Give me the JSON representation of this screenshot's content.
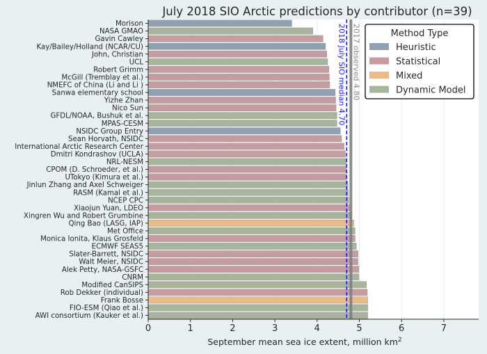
{
  "chart_data": {
    "type": "bar",
    "orientation": "horizontal",
    "title": "July 2018 SIO Arctic predictions by contributor (n=39)",
    "xlabel": "September mean sea ice extent, million km",
    "xlabel_superscript": "2",
    "ylabel": "",
    "xlim": [
      0,
      7.8
    ],
    "xticks": [
      0,
      1,
      2,
      3,
      4,
      5,
      6,
      7
    ],
    "grid": "vertical",
    "method_colors": {
      "Heuristic": "#8ea0b2",
      "Statistical": "#c59ca0",
      "Mixed": "#ebbb86",
      "Dynamic Model": "#a9b59b"
    },
    "legend": {
      "title": "Method Type",
      "placement": "top-right",
      "entries": [
        "Heuristic",
        "Statistical",
        "Mixed",
        "Dynamic Model"
      ]
    },
    "reference_lines": [
      {
        "name": "median",
        "value": 4.7,
        "label": "2018 July SIO median 4.70",
        "color": "#1a1aff",
        "style": "dashed"
      },
      {
        "name": "observed",
        "value": 4.8,
        "label": "2017 observed 4.80",
        "color": "#808080",
        "style": "solid"
      }
    ],
    "categories": [
      "Morison",
      "NASA GMAO",
      "Gavin Cawley",
      "Kay/Bailey/Holland (NCAR/CU)",
      "John, Christian",
      "UCL",
      "Robert Grimm",
      "McGill (Tremblay et al.)",
      "NMEFC of China (Li and Li )",
      "Sanwa elementary school",
      "Yizhe Zhan",
      "Nico Sun",
      "GFDL/NOAA, Bushuk et al.",
      "MPAS-CESM",
      "NSIDC Group Entry",
      "Sean Horvath, NSIDC",
      "International Arctic Research Center",
      "Dmitri Kondrashov (UCLA)",
      "NRL-NESM",
      "CPOM (D. Schroeder, et al.)",
      "UTokyo (Kimura et al.)",
      "Jinlun Zhang and Axel Schweiger",
      "RASM (Kamal et al.)",
      "NCEP CPC",
      "Xiaojun Yuan, LDEO",
      "Xingren Wu and Robert Grumbine",
      "Qing Bao (LASG, IAP)",
      "Met Office",
      "Monica Ionita, Klaus Grosfeld",
      "ECMWF SEAS5",
      "Slater-Barrett, NSIDC",
      "Walt Meier, NSIDC",
      "Alek Petty, NASA-GSFC",
      "CNRM",
      "Modified CanSIPS",
      "Rob Dekker (individual)",
      "Frank Bosse",
      "FIO-ESM (Qiao et al.)",
      "AWI consortium (Kauker et al.)"
    ],
    "values": [
      3.4,
      3.9,
      4.14,
      4.2,
      4.23,
      4.25,
      4.28,
      4.29,
      4.3,
      4.43,
      4.44,
      4.45,
      4.47,
      4.47,
      4.55,
      4.58,
      4.64,
      4.67,
      4.69,
      4.7,
      4.7,
      4.73,
      4.74,
      4.75,
      4.77,
      4.82,
      4.87,
      4.9,
      4.9,
      4.93,
      4.97,
      4.97,
      4.99,
      4.99,
      5.17,
      5.19,
      5.2,
      5.2,
      5.2
    ],
    "methods": [
      "Heuristic",
      "Dynamic Model",
      "Statistical",
      "Heuristic",
      "Statistical",
      "Dynamic Model",
      "Statistical",
      "Statistical",
      "Statistical",
      "Heuristic",
      "Statistical",
      "Statistical",
      "Dynamic Model",
      "Dynamic Model",
      "Heuristic",
      "Statistical",
      "Statistical",
      "Statistical",
      "Dynamic Model",
      "Statistical",
      "Statistical",
      "Dynamic Model",
      "Dynamic Model",
      "Dynamic Model",
      "Statistical",
      "Dynamic Model",
      "Mixed",
      "Dynamic Model",
      "Statistical",
      "Dynamic Model",
      "Statistical",
      "Statistical",
      "Statistical",
      "Dynamic Model",
      "Dynamic Model",
      "Statistical",
      "Mixed",
      "Dynamic Model",
      "Dynamic Model"
    ]
  }
}
